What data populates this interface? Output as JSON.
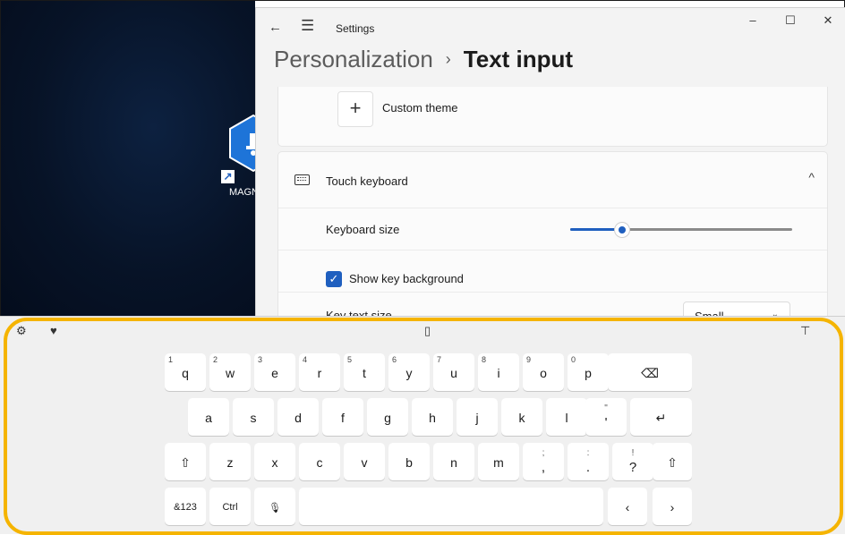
{
  "desktop": {
    "app_label": "MAGN",
    "shortcut_arrow": "↗",
    "icon": "app-hexagon-icon"
  },
  "settings": {
    "titlebar": {
      "back_icon": "←",
      "menu_icon": "☰",
      "title": "Settings",
      "minimize": "–",
      "maximize": "☐",
      "close": "✕"
    },
    "breadcrumb": {
      "parent": "Personalization",
      "separator": "›",
      "current": "Text input"
    },
    "custom_theme": {
      "icon": "+",
      "label": "Custom theme"
    },
    "touch_keyboard": {
      "label": "Touch keyboard",
      "icon": "keyboard-icon",
      "chevron": "^",
      "keyboard_size_label": "Keyboard size",
      "keyboard_size_fraction": 0.23,
      "show_key_background_label": "Show key background",
      "show_key_background_checked": true,
      "checkmark": "✓",
      "key_text_size_label": "Key text size",
      "key_text_size_value": "Small",
      "dropdown_chevron": "⌄"
    }
  },
  "keyboard": {
    "toolbar": {
      "settings_icon": "⚙",
      "emoji_icon": "♥",
      "clipboard_icon": "▯",
      "dock_icon": "⊤"
    },
    "row1": [
      {
        "label": "q",
        "sup": "1"
      },
      {
        "label": "w",
        "sup": "2"
      },
      {
        "label": "e",
        "sup": "3"
      },
      {
        "label": "r",
        "sup": "4"
      },
      {
        "label": "t",
        "sup": "5"
      },
      {
        "label": "y",
        "sup": "6"
      },
      {
        "label": "u",
        "sup": "7"
      },
      {
        "label": "i",
        "sup": "8"
      },
      {
        "label": "o",
        "sup": "9"
      },
      {
        "label": "p",
        "sup": "0"
      }
    ],
    "backspace": "⌫",
    "row2": [
      "a",
      "s",
      "d",
      "f",
      "g",
      "h",
      "j",
      "k",
      "l"
    ],
    "quote_key": {
      "top": "\"",
      "bottom": "'"
    },
    "enter": "↵",
    "shift": "⇧",
    "row3": [
      "z",
      "x",
      "c",
      "v",
      "b",
      "n",
      "m"
    ],
    "punct_keys": [
      {
        "top": ";",
        "bottom": ","
      },
      {
        "top": ":",
        "bottom": "."
      },
      {
        "top": "!",
        "bottom": "?"
      }
    ],
    "row4": {
      "numbers": "&123",
      "ctrl": "Ctrl",
      "mic": "🎙",
      "left": "‹",
      "right": "›"
    }
  }
}
